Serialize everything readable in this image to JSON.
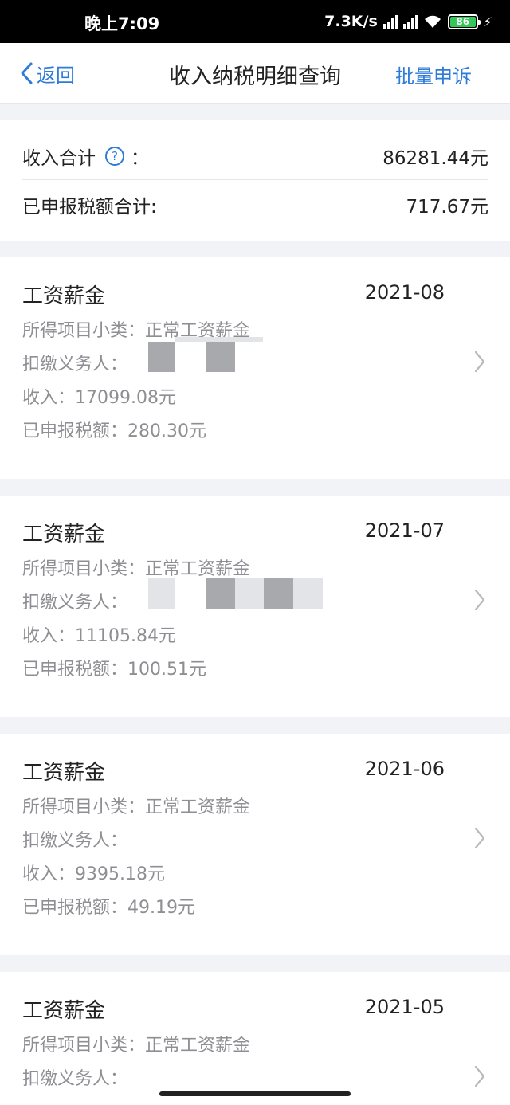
{
  "status_bar": {
    "time": "晚上7:09",
    "net_speed": "7.3K/s",
    "battery": "86"
  },
  "nav": {
    "back_label": "返回",
    "title": "收入纳税明细查询",
    "batch_label": "批量申诉"
  },
  "summary": {
    "income_label": "收入合计",
    "income_help_icon": "question-circle-icon",
    "income_colon": "：",
    "income_value": "86281.44元",
    "tax_label": "已申报税额合计:",
    "tax_value": "717.67元"
  },
  "records": [
    {
      "title": "工资薪金",
      "date": "2021-08",
      "subcategory": "所得项目小类：正常工资薪金",
      "withholder": "扣缴义务人：",
      "income": "收入：17099.08元",
      "tax": "已申报税额：280.30元"
    },
    {
      "title": "工资薪金",
      "date": "2021-07",
      "subcategory": "所得项目小类：正常工资薪金",
      "withholder": "扣缴义务人：",
      "income": "收入：11105.84元",
      "tax": "已申报税额：100.51元"
    },
    {
      "title": "工资薪金",
      "date": "2021-06",
      "subcategory": "所得项目小类：正常工资薪金",
      "withholder": "扣缴义务人：",
      "income": "收入：9395.18元",
      "tax": "已申报税额：49.19元"
    },
    {
      "title": "工资薪金",
      "date": "2021-05",
      "subcategory": "所得项目小类：正常工资薪金",
      "withholder": "扣缴义务人：",
      "income": "",
      "tax": ""
    }
  ],
  "colors": {
    "accent": "#2f7cd8",
    "background": "#f2f3f7",
    "secondary_text": "#8e8e93"
  }
}
